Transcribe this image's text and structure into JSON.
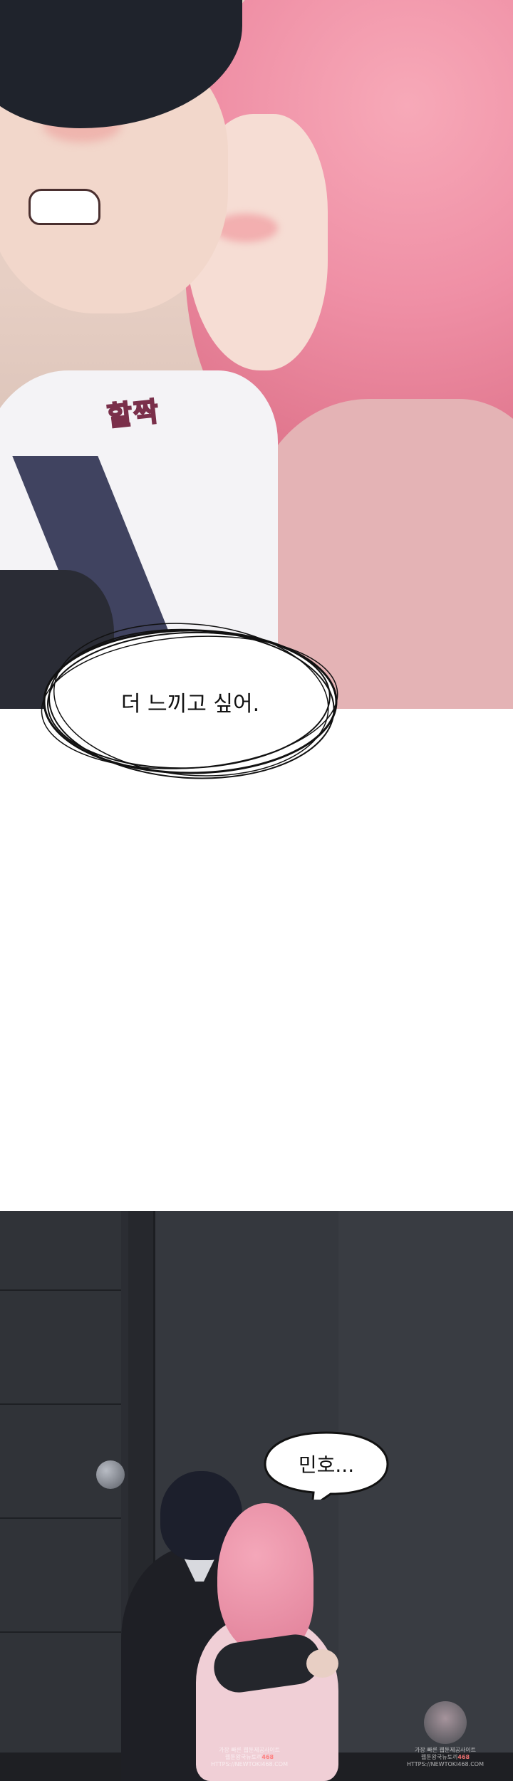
{
  "panel1": {
    "sfx": "할짝",
    "speech": "더 느끼고 싶어."
  },
  "panel2": {
    "speech": "민호..."
  },
  "watermark": {
    "line1": "가장 빠른 웹툰제공사이트",
    "line2": "웹툰왕국뉴토끼",
    "number": "468",
    "line3": "HTTPS://NEWTOKI468.COM"
  }
}
